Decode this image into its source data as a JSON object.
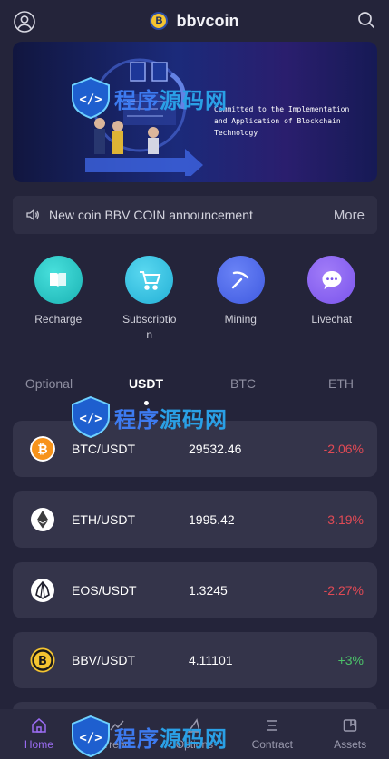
{
  "header": {
    "title": "bbvcoin",
    "logo_letter": "B"
  },
  "banner": {
    "text_lines": [
      "Committed to the Implementation",
      "and Application of Blockchain",
      "Technology"
    ]
  },
  "notice": {
    "text": "New coin BBV COIN announcement",
    "more": "More"
  },
  "actions": [
    {
      "label": "Recharge",
      "icon": "book-icon"
    },
    {
      "label": "Subscription",
      "icon": "cart-icon"
    },
    {
      "label": "Mining",
      "icon": "pickaxe-icon"
    },
    {
      "label": "Livechat",
      "icon": "chat-icon"
    }
  ],
  "tabs": [
    {
      "label": "Optional",
      "active": false
    },
    {
      "label": "USDT",
      "active": true
    },
    {
      "label": "BTC",
      "active": false
    },
    {
      "label": "ETH",
      "active": false
    }
  ],
  "markets": [
    {
      "pair": "BTC/USDT",
      "price": "29532.46",
      "change": "-2.06%",
      "direction": "down",
      "coin_color": "#f7931a"
    },
    {
      "pair": "ETH/USDT",
      "price": "1995.42",
      "change": "-3.19%",
      "direction": "down",
      "coin_color": "#ffffff"
    },
    {
      "pair": "EOS/USDT",
      "price": "1.3245",
      "change": "-2.27%",
      "direction": "down",
      "coin_color": "#ffffff"
    },
    {
      "pair": "BBV/USDT",
      "price": "4.11101",
      "change": "+3%",
      "direction": "up",
      "coin_color": "#f4c430"
    }
  ],
  "nav": [
    {
      "label": "Home",
      "active": true,
      "icon": "home-icon"
    },
    {
      "label": "Trend",
      "active": false,
      "icon": "trend-icon"
    },
    {
      "label": "Options",
      "active": false,
      "icon": "options-icon"
    },
    {
      "label": "Contract",
      "active": false,
      "icon": "contract-icon"
    },
    {
      "label": "Assets",
      "active": false,
      "icon": "wallet-icon"
    }
  ],
  "watermark": {
    "cn_a": "程序",
    "cn_b": "源码网"
  },
  "colors": {
    "accent": "#9b6cf3",
    "down": "#e04a55",
    "up": "#4cc36a",
    "background": "#24243a",
    "card": "#34344a"
  }
}
